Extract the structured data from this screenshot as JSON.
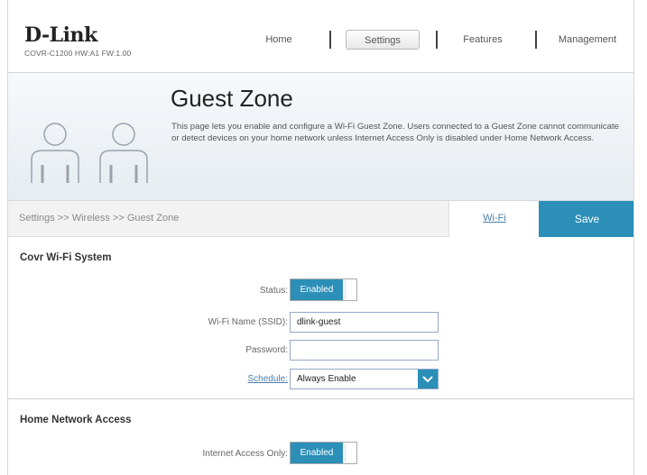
{
  "header": {
    "brand": "D-Link",
    "model": "COVR-C1200 HW:A1 FW:1.00",
    "nav": [
      {
        "label": "Home"
      },
      {
        "label": "Settings"
      },
      {
        "label": "Features"
      },
      {
        "label": "Management"
      }
    ],
    "active_nav": "Settings"
  },
  "banner": {
    "title": "Guest Zone",
    "description": "This page lets you enable and configure a Wi-Fi Guest Zone. Users connected to a Guest Zone cannot communicate or detect devices on your home network unless Internet Access Only is disabled under Home Network Access."
  },
  "breadcrumb": "Settings >> Wireless >> Guest Zone",
  "wifi_link": "Wi-Fi",
  "save_label": "Save",
  "covr": {
    "title": "Covr Wi-Fi System",
    "status_label": "Status:",
    "status_value": "Enabled",
    "ssid_label": "Wi-Fi Name (SSID):",
    "ssid_value": "dlink-guest",
    "password_label": "Password:",
    "password_value": "",
    "schedule_label": "Schedule:",
    "schedule_value": "Always Enable"
  },
  "home_network": {
    "title": "Home Network Access",
    "internet_only_label": "Internet Access Only:",
    "internet_only_value": "Enabled"
  },
  "colors": {
    "accent": "#2b8fb8",
    "link": "#4a7fb0"
  }
}
